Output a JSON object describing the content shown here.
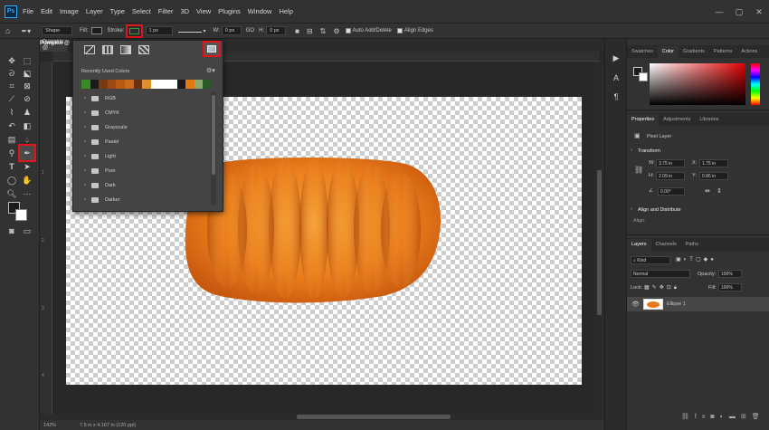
{
  "app": {
    "logo": "Ps"
  },
  "menu": [
    "File",
    "Edit",
    "Image",
    "Layer",
    "Type",
    "Select",
    "Filter",
    "3D",
    "View",
    "Plugins",
    "Window",
    "Help"
  ],
  "window_controls": [
    "—",
    "▢",
    "✕"
  ],
  "options": {
    "mode": "Shape",
    "fill_label": "Fill:",
    "stroke_label": "Stroke:",
    "stroke_size": "1 px",
    "w_label": "W:",
    "w_value": "0 px",
    "link": "GO",
    "h_label": "H:",
    "h_value": "0 px",
    "auto_add_delete": "Auto Add/Delete",
    "align_edges": "Align Edges",
    "stroke_color": "#3a9a3a"
  },
  "document": {
    "tab": "Pumpkin @",
    "zoom": "142%",
    "status": "7.5 in x 4.167 in (120 ppi)"
  },
  "ruler_v": [
    "1",
    "2",
    "3",
    "4"
  ],
  "stroke_popup": {
    "title": "Pumpkin @",
    "recent_label": "Recently Used Colors",
    "recent_colors": [
      "#3a8a2a",
      "#1a1a1a",
      "#7a3a10",
      "#9a4a12",
      "#b85a10",
      "#c86a1a",
      "#6a3010",
      "#e0902a",
      "#ffffff",
      "#ffffff",
      "#ffffff",
      "#1a1a1a",
      "#e07a10",
      "#8aa870",
      "#2a5a2a"
    ],
    "folders": [
      "RGB",
      "CMYK",
      "Grayscale",
      "Pastel",
      "Light",
      "Pure",
      "Dark",
      "Darker"
    ]
  },
  "swatches_panel": {
    "tabs": [
      "Swatches",
      "Color",
      "Gradients",
      "Patterns",
      "Actions"
    ],
    "active": "Color"
  },
  "properties": {
    "tabs": [
      "Properties",
      "Adjustments",
      "Libraries"
    ],
    "type": "Pixel Layer",
    "transform": "Transform",
    "w": "3.75 in",
    "x": "1.75 in",
    "h": "2.09 in",
    "y": "0.86 in",
    "angle": "0.00°",
    "align": "Align and Distribute",
    "align_sub": "Align:"
  },
  "layers": {
    "tabs": [
      "Layers",
      "Channels",
      "Paths"
    ],
    "kind": "Kind",
    "blend": "Normal",
    "opacity_label": "Opacity:",
    "opacity": "100%",
    "lock_label": "Lock:",
    "fill_label": "Fill:",
    "fill": "100%",
    "layer_name": "Ellipse 1"
  },
  "colors": {
    "accent": "#31a8ff",
    "highlight": "#e0141a",
    "pumpkin": "#e8781a"
  }
}
